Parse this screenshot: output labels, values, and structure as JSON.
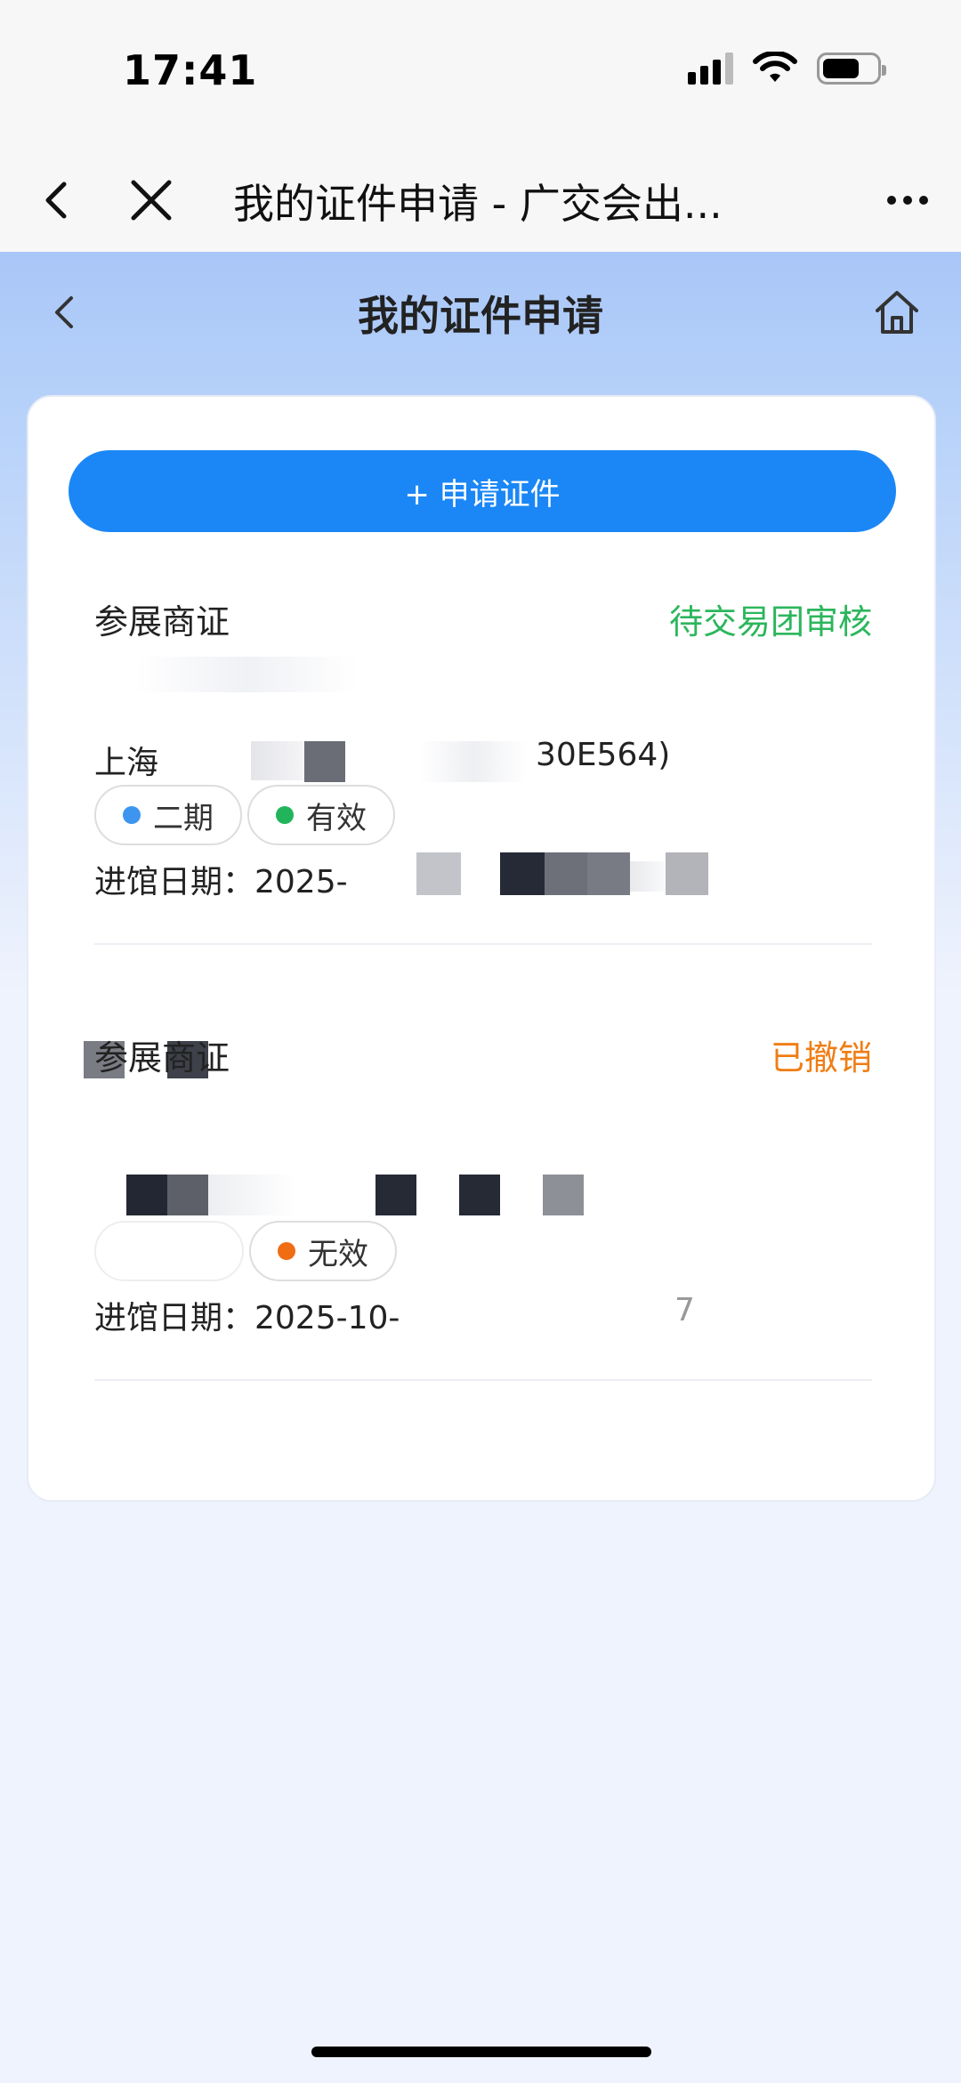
{
  "status_bar": {
    "time": "17:41"
  },
  "browser": {
    "title": "我的证件申请 - 广交会出..."
  },
  "header": {
    "title": "我的证件申请"
  },
  "apply_button": {
    "label": "+ 申请证件"
  },
  "items": [
    {
      "type": "参展商证",
      "status": "待交易团审核",
      "status_color": "#2cb65c",
      "company": "上海",
      "company_suffix": "30E564)",
      "tags": [
        {
          "label": "二期",
          "dot_color": "#3e95f0"
        },
        {
          "label": "有效",
          "dot_color": "#22b45b"
        }
      ],
      "date_label": "进馆日期：2025-"
    },
    {
      "type": "参展商证",
      "status": "已撤销",
      "status_color": "#f07d14",
      "tags": [
        {
          "label": "",
          "dot_color": ""
        },
        {
          "label": "无效",
          "dot_color": "#f06d14"
        }
      ],
      "date_label": "进馆日期：2025-10-",
      "date_suffix": "7"
    }
  ],
  "colors": {
    "primary": "#1b87f6",
    "header_bg": "#a9c6f8",
    "page_bg": "#eff3fd"
  }
}
